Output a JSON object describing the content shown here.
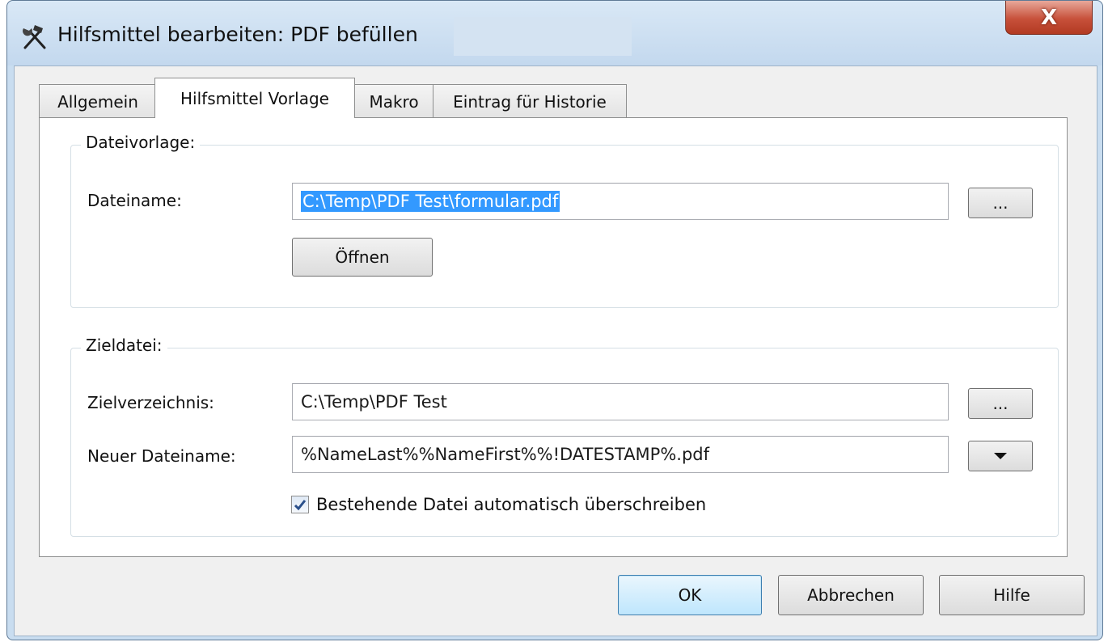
{
  "window": {
    "title": "Hilfsmittel bearbeiten:  PDF befüllen",
    "close_label": "X"
  },
  "tabs": [
    {
      "label": "Allgemein",
      "active": false
    },
    {
      "label": "Hilfsmittel Vorlage",
      "active": true
    },
    {
      "label": "Makro",
      "active": false
    },
    {
      "label": "Eintrag für Historie",
      "active": false
    }
  ],
  "dateivorlage": {
    "group_label": "Dateivorlage:",
    "dateiname_label": "Dateiname:",
    "dateiname_value": "C:\\Temp\\PDF Test\\formular.pdf",
    "browse_label": "...",
    "open_label": "Öffnen"
  },
  "zieldatei": {
    "group_label": "Zieldatei:",
    "zielverzeichnis_label": "Zielverzeichnis:",
    "zielverzeichnis_value": "C:\\Temp\\PDF Test",
    "browse_label": "...",
    "neuer_dateiname_label": "Neuer Dateiname:",
    "neuer_dateiname_value": "%NameLast%%NameFirst%%!DATESTAMP%.pdf",
    "overwrite_label": "Bestehende Datei automatisch überschreiben",
    "overwrite_checked": true
  },
  "footer": {
    "ok_label": "OK",
    "cancel_label": "Abbrechen",
    "help_label": "Hilfe"
  }
}
